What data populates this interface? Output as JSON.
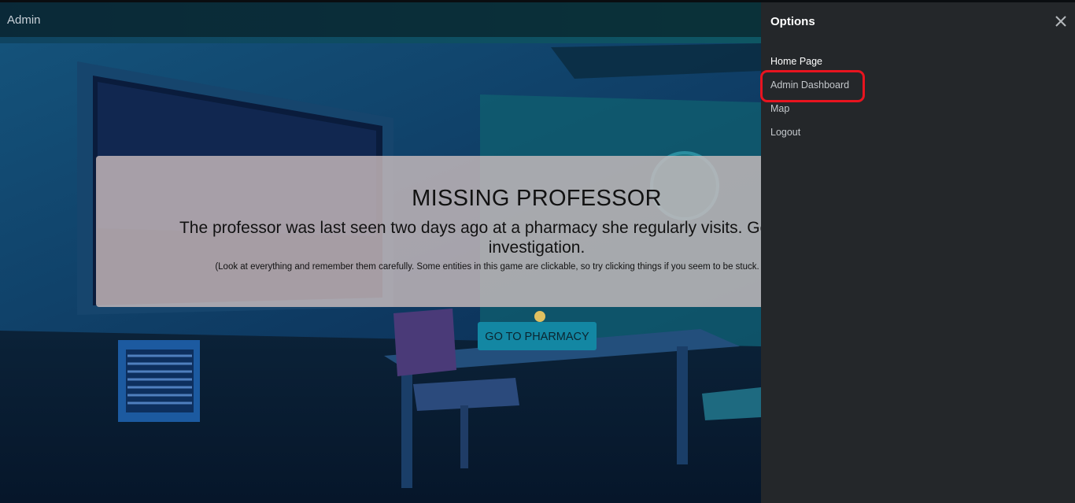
{
  "navbar": {
    "brand": "Admin"
  },
  "intro": {
    "title": "MISSING PROFESSOR",
    "description": "The professor was last seen two days ago at a pharmacy she regularly visits. Go there to start the investigation.",
    "hint": "(Look at everything and remember them carefully. Some entities in this game are clickable, so try clicking things if you seem to be stuck. Anything can be a clue.)",
    "button_label": "GO TO PHARMACY"
  },
  "sidebar": {
    "title": "Options",
    "close_icon": "close-icon",
    "items": [
      {
        "label": "Home Page"
      },
      {
        "label": "Admin Dashboard"
      },
      {
        "label": "Map"
      },
      {
        "label": "Logout"
      }
    ]
  },
  "colors": {
    "sidebar_bg": "#24272a",
    "button_bg": "#1387a3",
    "highlight": "#e8141f",
    "card_bg": "#cdbebe"
  }
}
